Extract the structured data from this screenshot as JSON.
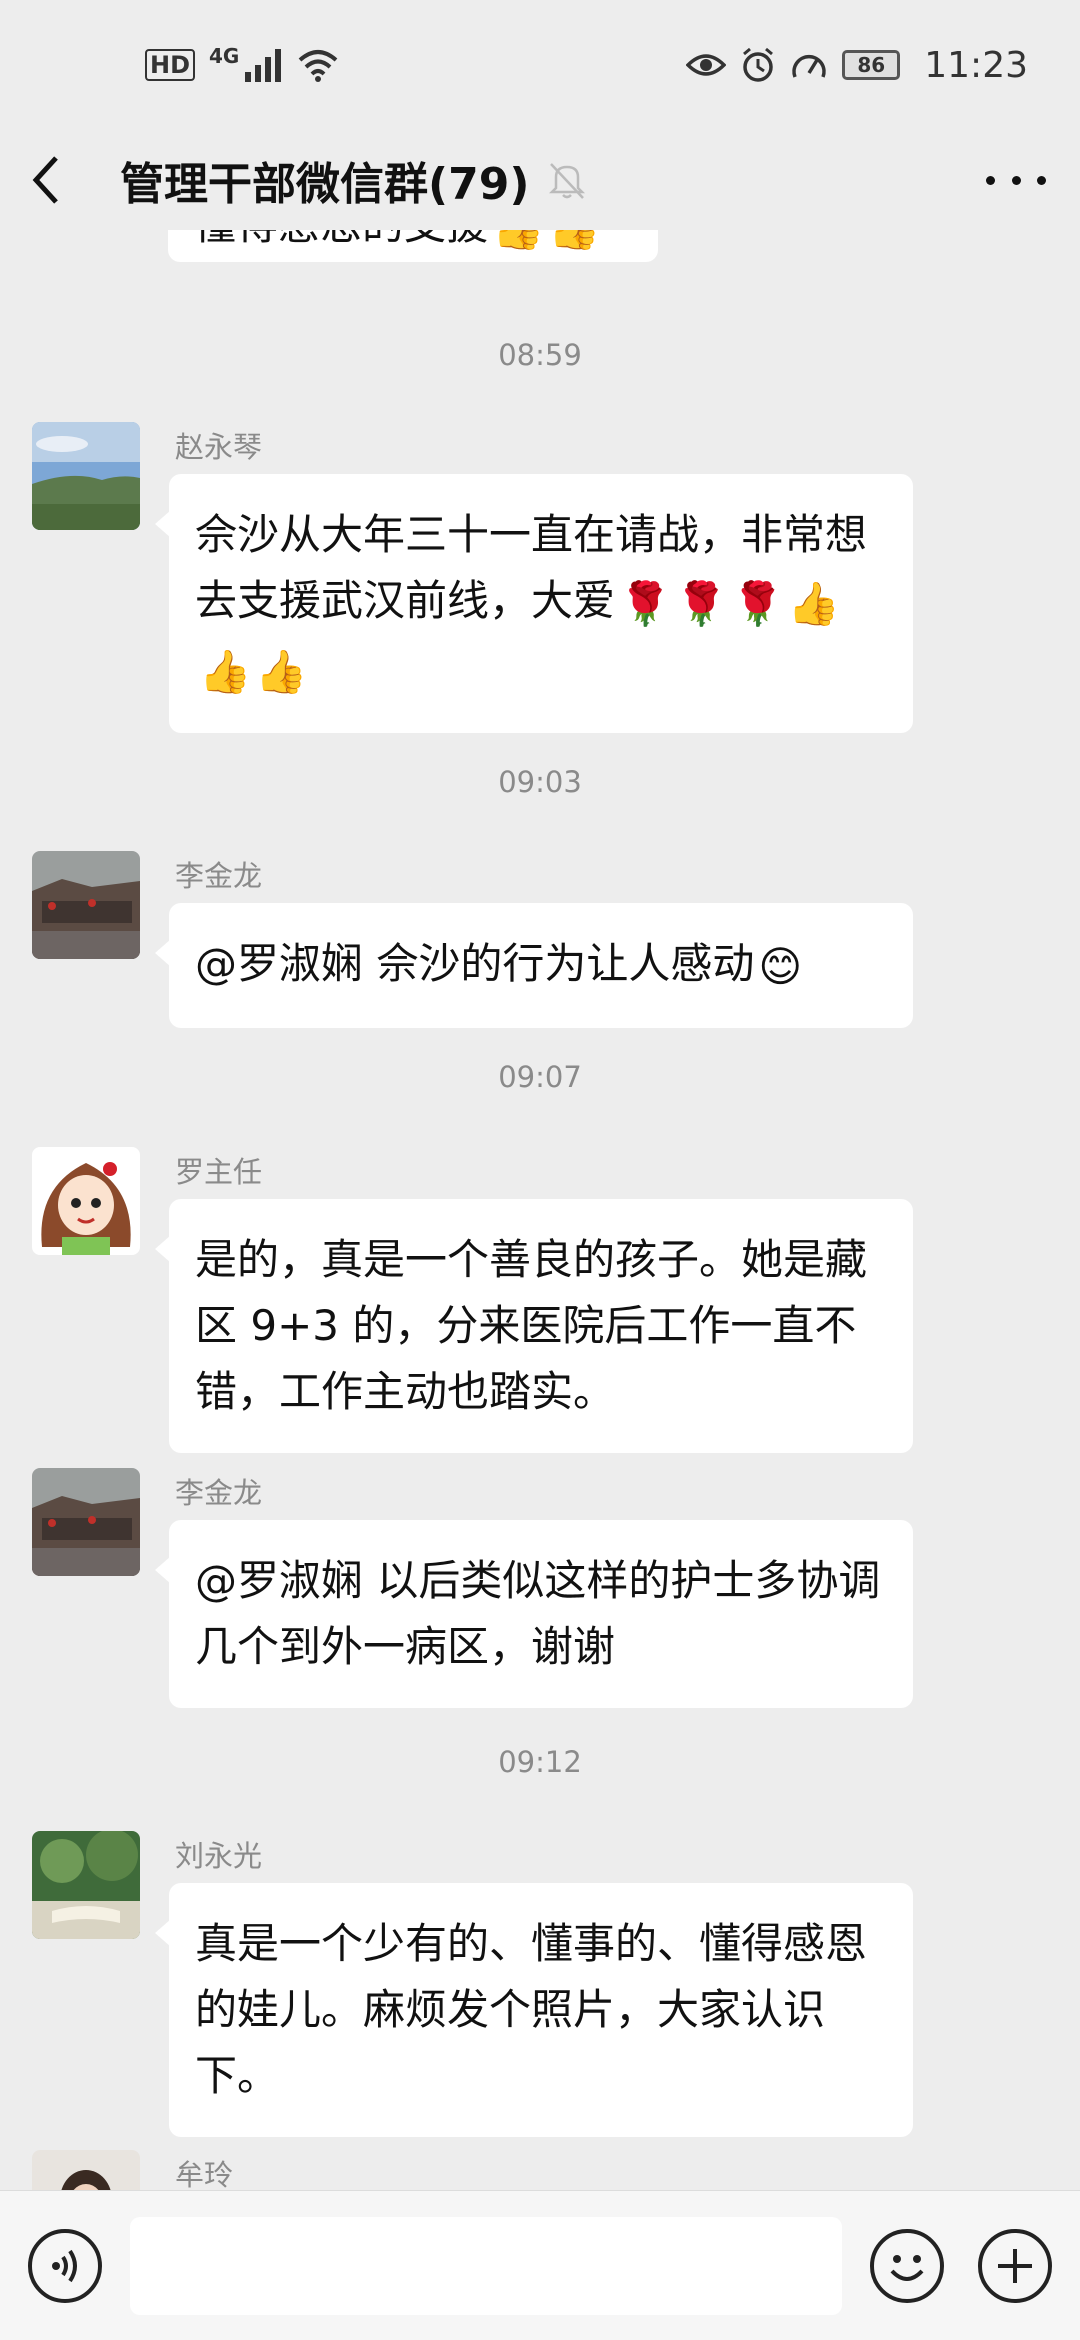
{
  "status_bar": {
    "hd": "HD",
    "network": "4G",
    "battery": "86",
    "time": "11:23"
  },
  "header": {
    "title": "管理干部微信群(79)"
  },
  "messages": {
    "prev_partial_text": "懂得感恩的支援",
    "t1": "08:59",
    "m1": {
      "sender": "赵永琴",
      "text": "佘沙从大年三十一直在请战，非常想去支援武汉前线，大爱"
    },
    "t2": "09:03",
    "m2": {
      "sender": "李金龙",
      "text": "@罗淑娴  佘沙的行为让人感动"
    },
    "t3": "09:07",
    "m3": {
      "sender": "罗主任",
      "text": "是的，真是一个善良的孩子。她是藏区 9+3 的，分来医院后工作一直不错，工作主动也踏实。"
    },
    "m4": {
      "sender": "李金龙",
      "text": "@罗淑娴  以后类似这样的护士多协调几个到外一病区，谢谢"
    },
    "t4": "09:12",
    "m5": {
      "sender": "刘永光",
      "text": "真是一个少有的、懂事的、懂得感恩的娃儿。麻烦发个照片，大家认识下。"
    },
    "m6": {
      "sender": "牟玲"
    }
  },
  "colors": {
    "background": "#EDEDED",
    "bubble": "#FFFFFF",
    "meta_text": "#8A8A8A"
  }
}
